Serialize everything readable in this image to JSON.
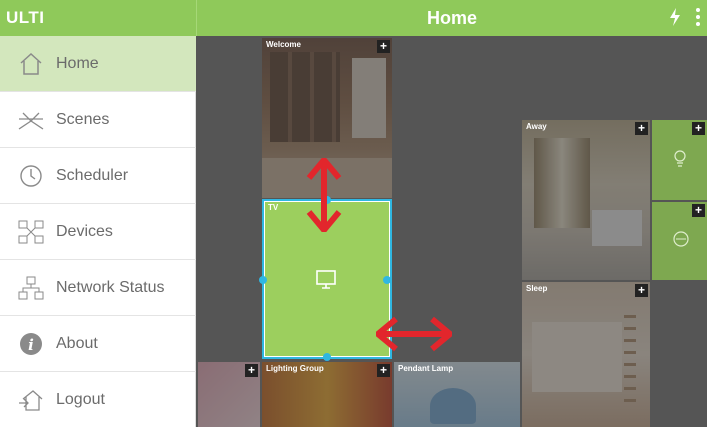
{
  "header": {
    "app_name": "ULTI",
    "title": "Home",
    "bolt_icon": "bolt-icon",
    "menu_icon": "kebab-menu-icon"
  },
  "sidebar": {
    "items": [
      {
        "label": "Home",
        "icon": "house-icon",
        "active": true
      },
      {
        "label": "Scenes",
        "icon": "scenes-icon",
        "active": false
      },
      {
        "label": "Scheduler",
        "icon": "clock-icon",
        "active": false
      },
      {
        "label": "Devices",
        "icon": "devices-icon",
        "active": false
      },
      {
        "label": "Network Status",
        "icon": "network-icon",
        "active": false
      },
      {
        "label": "About",
        "icon": "info-icon",
        "active": false
      },
      {
        "label": "Logout",
        "icon": "logout-icon",
        "active": false
      }
    ]
  },
  "tiles": {
    "welcome": "Welcome",
    "tv": "TV",
    "away": "Away",
    "sleep": "Sleep",
    "lighting": "Lighting Group",
    "ambient": "Pendant Lamp",
    "plus": "+"
  },
  "colors": {
    "accent": "#8fc95a",
    "active_nav": "#d3e7bd",
    "selection": "#2fb7e2",
    "arrow": "#e2262c"
  }
}
